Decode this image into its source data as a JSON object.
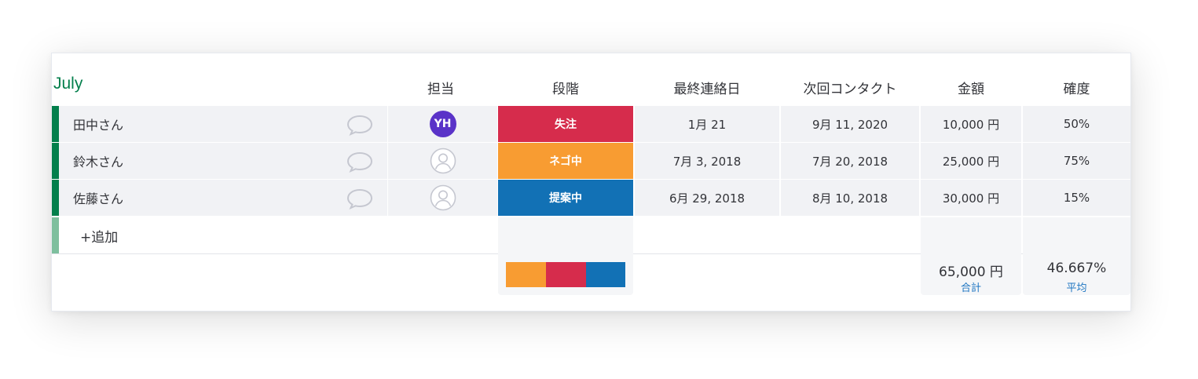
{
  "group": {
    "title": "July",
    "color": "#037f4c",
    "add_row_label": "+追加",
    "add_row_bar_color": "#7ebf9e"
  },
  "columns": {
    "owner": "担当",
    "status": "段階",
    "last_contact": "最終連絡日",
    "next_contact": "次回コンタクト",
    "amount": "金額",
    "probability": "確度"
  },
  "rows": [
    {
      "name": "田中さん",
      "owner_initials": "YH",
      "owner_has_avatar": true,
      "status": "失注",
      "status_color": "#d62c4c",
      "last_contact": "1月 21",
      "next_contact": "9月 11, 2020",
      "amount": "10,000 円",
      "probability": "50%"
    },
    {
      "name": "鈴木さん",
      "owner_initials": "",
      "owner_has_avatar": false,
      "status": "ネゴ中",
      "status_color": "#f89c32",
      "last_contact": "7月 3, 2018",
      "next_contact": "7月 20, 2018",
      "amount": "25,000 円",
      "probability": "75%"
    },
    {
      "name": "佐藤さん",
      "owner_initials": "",
      "owner_has_avatar": false,
      "status": "提案中",
      "status_color": "#1271b5",
      "last_contact": "6月 29, 2018",
      "next_contact": "8月 10, 2018",
      "amount": "30,000 円",
      "probability": "15%"
    }
  ],
  "summary": {
    "status_distribution": [
      {
        "status": "ネゴ中",
        "color": "#f89c32",
        "fraction": 0.3333
      },
      {
        "status": "失注",
        "color": "#d62c4c",
        "fraction": 0.3333
      },
      {
        "status": "提案中",
        "color": "#1271b5",
        "fraction": 0.3334
      }
    ],
    "amount_total": "65,000 円",
    "amount_label": "合計",
    "probability_avg": "46.667%",
    "probability_label": "平均"
  },
  "icons": {
    "comment": "comment-icon",
    "person": "person-icon"
  }
}
